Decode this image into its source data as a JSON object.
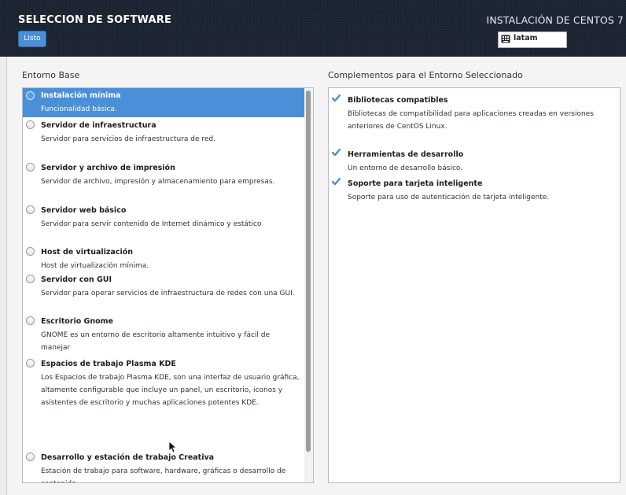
{
  "header": {
    "title": "SELECCION DE SOFTWARE",
    "done_label": "Listo",
    "install_title": "INSTALACIÓN DE CENTOS 7",
    "keyboard_layout": "latam",
    "keyboard_icon": "keyboard-icon"
  },
  "base_env": {
    "heading": "Entorno Base",
    "items": [
      {
        "title": "Instalación mínima",
        "desc": "Funcionalidad básica.",
        "selected": true
      },
      {
        "title": "Servidor de infraestructura",
        "desc": "Servidor para servicios de infraestructura de red."
      },
      {
        "title": "Servidor y archivo de impresión",
        "desc": "Servidor de archivo, impresión y almacenamiento para empresas."
      },
      {
        "title": "Servidor web básico",
        "desc": "Servidor para servir contenido de Internet dinámico y estático"
      },
      {
        "title": "Host de virtualización",
        "desc": "Host de virtualización mínima."
      },
      {
        "title": "Servidor con GUI",
        "desc": "Servidor para operar servicios de infraestructura de redes con una GUI."
      },
      {
        "title": "Escritorio Gnome",
        "desc": "GNOME es un entorno de escritorio altamente intuitivo y fácil de manejar"
      },
      {
        "title": "Espacios de trabajo Plasma KDE",
        "desc": "Los Espacios de trabajo Plasma KDE, son una interfaz de usuario gráfica, altamente configurable que incluye un panel, un escritorio, iconos y asistentes de escritorio y muchas aplicaciones potentes KDE."
      },
      {
        "title": "Desarrollo y estación de trabajo Creativa",
        "desc": "Estación de trabajo para software, hardware, gráficas o desarrollo de contenido."
      }
    ]
  },
  "addons": {
    "heading": "Complementos para el Entorno Seleccionado",
    "items": [
      {
        "title": "Bibliotecas compatibles",
        "desc": "Bibliotecas de compatibilidad para aplicaciones creadas en versiones anteriores de CentOS Linux.",
        "checked": true
      },
      {
        "title": "Herramientas de desarrollo",
        "desc": "Un entorno de desarrollo básico.",
        "checked": true
      },
      {
        "title": "Soporte para tarjeta inteligente",
        "desc": "Soporte para uso de autenticación de tarjeta inteligente.",
        "checked": true
      }
    ]
  },
  "colors": {
    "header_bg": "#1a2330",
    "selection": "#4a90d9",
    "button": "#4a8fd8"
  }
}
